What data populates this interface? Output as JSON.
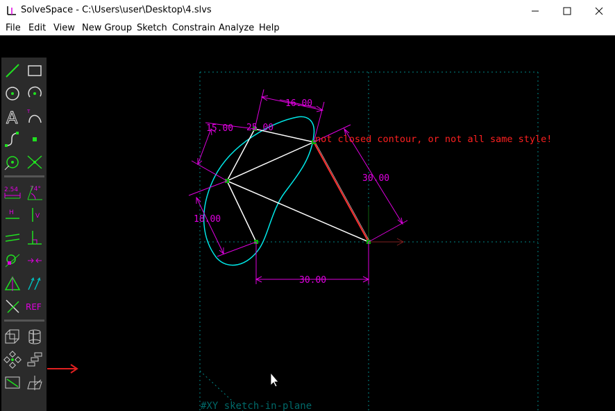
{
  "window": {
    "title": "SolveSpace - C:\\Users\\user\\Desktop\\4.slvs",
    "controls": [
      "minimize",
      "maximize",
      "close"
    ]
  },
  "menu": [
    "File",
    "Edit",
    "View",
    "New Group",
    "Sketch",
    "Constrain",
    "Analyze",
    "Help"
  ],
  "sketch": {
    "dimensions": {
      "d_25": "25.00",
      "d_16": "16.00",
      "d_15": "15.00",
      "d_30_right": "30.00",
      "d_18": "18.00",
      "d_30_bottom": "30.00"
    },
    "error_message": "not closed contour, or not all same style!",
    "group_label": "#XY  sketch-in-plane"
  },
  "toolbar": {
    "dim_label": "2.54",
    "angle_label": "74°",
    "horiz_label": "H",
    "vert_label": "V",
    "ref_label": "REF"
  },
  "colors": {
    "constraint": "#e000e0",
    "curve": "#00e8e8",
    "line": "#ffffff",
    "error": "#ff2020",
    "point": "#00c000",
    "grid": "#008888",
    "tool_green": "#20e020"
  }
}
